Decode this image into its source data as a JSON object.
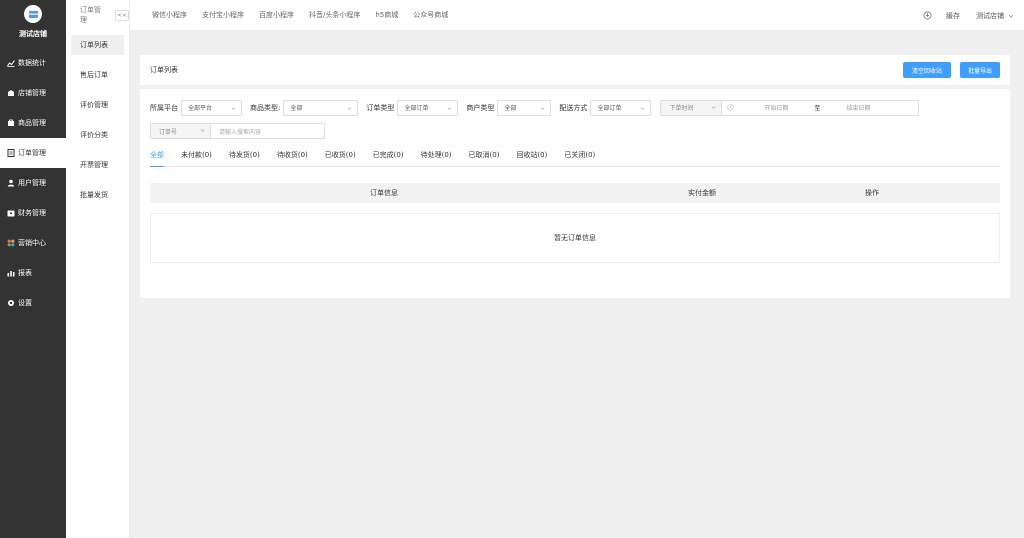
{
  "sidebar": {
    "store_name": "测试店铺",
    "items": [
      {
        "label": "数据统计",
        "icon": "chart-line-icon"
      },
      {
        "label": "店铺管理",
        "icon": "shop-icon"
      },
      {
        "label": "商品管理",
        "icon": "goods-icon"
      },
      {
        "label": "订单管理",
        "icon": "order-list-icon"
      },
      {
        "label": "用户管理",
        "icon": "user-icon"
      },
      {
        "label": "财务管理",
        "icon": "wallet-icon"
      },
      {
        "label": "营销中心",
        "icon": "marketing-icon"
      },
      {
        "label": "报表",
        "icon": "report-icon"
      },
      {
        "label": "设置",
        "icon": "gear-icon"
      }
    ],
    "active_index": 3
  },
  "submenu": {
    "title": "订单管理",
    "collapse_label": "<<",
    "items": [
      "订单列表",
      "售后订单",
      "评价管理",
      "评价分类",
      "开票管理",
      "批量发货"
    ]
  },
  "topbar": {
    "platforms": [
      "微信小程序",
      "支付宝小程序",
      "百度小程序",
      "抖音/头条小程序",
      "h5商城",
      "公众号商城"
    ],
    "cache_label": "缓存",
    "user_label": "测试店铺"
  },
  "page": {
    "title": "订单列表",
    "clear_recycle_label": "清空回收站",
    "export_label": "批量导出"
  },
  "filters": {
    "platform_label": "所属平台",
    "platform_value": "全部平台",
    "goods_type_label": "商品类型:",
    "goods_type_value": "全部",
    "order_type_label": "订单类型",
    "order_type_value": "全部订单",
    "merchant_type_label": "商户类型",
    "merchant_type_value": "全部",
    "delivery_label": "配送方式",
    "delivery_value": "全部订单",
    "date_type_value": "下单时间",
    "date_start_placeholder": "开始日期",
    "date_separator": "至",
    "date_end_placeholder": "结束日期",
    "search_type_value": "订单号",
    "search_placeholder": "请输入搜索内容"
  },
  "status_tabs": [
    "全部",
    "未付款(0)",
    "待发货(0)",
    "待收货(0)",
    "已收货(0)",
    "已完成(0)",
    "待处理(0)",
    "已取消(0)",
    "回收站(0)",
    "已关闭(0)"
  ],
  "table": {
    "headers": [
      "订单信息",
      "实付金额",
      "操作"
    ],
    "empty_text": "暂无订单信息"
  },
  "colors": {
    "accent": "#409eff",
    "sidebar_bg": "#333333"
  }
}
